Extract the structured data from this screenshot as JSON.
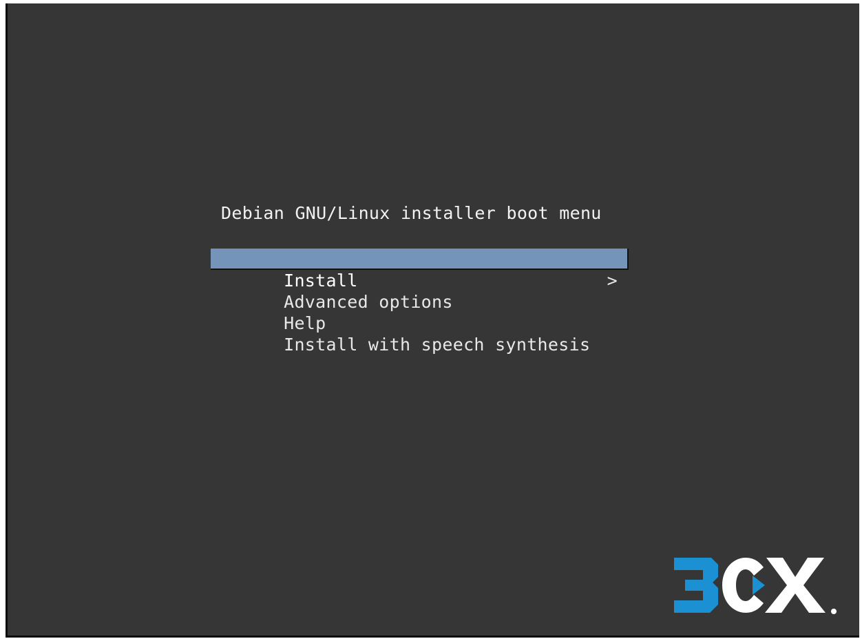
{
  "boot_menu": {
    "title": "Debian GNU/Linux installer boot menu",
    "items": [
      {
        "label": "Install",
        "selected": true
      },
      {
        "label": "Advanced options",
        "submenu_arrow": ">"
      },
      {
        "label": "Help"
      },
      {
        "label": "Install with speech synthesis"
      }
    ]
  },
  "logo": {
    "brand": "3CX",
    "trademark": "®",
    "colors": {
      "blue": "#1b91d4",
      "white": "#ffffff"
    }
  },
  "colors": {
    "background": "#363636",
    "highlight": "#7495b9",
    "text": "#e8e8e8"
  }
}
